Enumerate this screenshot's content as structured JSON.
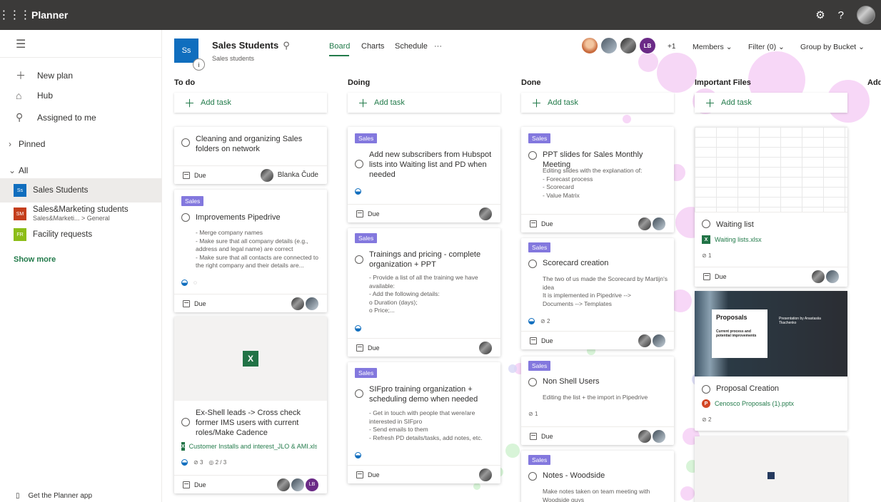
{
  "topbar": {
    "app_name": "Planner"
  },
  "sidebar": {
    "nav": [
      {
        "label": "New plan"
      },
      {
        "label": "Hub"
      },
      {
        "label": "Assigned to me"
      }
    ],
    "pinned_label": "Pinned",
    "all_label": "All",
    "plans": [
      {
        "abbr": "Ss",
        "name": "Sales Students",
        "sub": "",
        "color": "#106ebe"
      },
      {
        "abbr": "SM",
        "name": "Sales&Marketing students",
        "sub": "Sales&Marketi...  >  General",
        "color": "#c43e1c"
      },
      {
        "abbr": "FR",
        "name": "Facility requests",
        "sub": "",
        "color": "#8cbd18"
      }
    ],
    "show_more": "Show more",
    "get_app": "Get the Planner app"
  },
  "header": {
    "plan_abbr": "Ss",
    "plan_title": "Sales Students",
    "plan_sub": "Sales students",
    "tabs": [
      "Board",
      "Charts",
      "Schedule",
      "···"
    ],
    "member_initials": "LB",
    "more_count": "+1",
    "members": "Members",
    "filter": "Filter (0)",
    "group": "Group by Bucket"
  },
  "buckets": [
    {
      "name": "To do"
    },
    {
      "name": "Doing"
    },
    {
      "name": "Done"
    },
    {
      "name": "Important Files"
    },
    {
      "name": "Add"
    }
  ],
  "add_task": "Add task",
  "due": "Due",
  "label_sales": "Sales",
  "cards": {
    "t1": {
      "title": "Cleaning and organizing Sales folders on network",
      "assignee": "Blanka Čude"
    },
    "t2": {
      "title": "Improvements Pipedrive",
      "desc": "- Merge company names\n- Make sure that all company details (e.g., address and legal name) are correct\n- Make sure that all contacts are connected to the right company and their details are..."
    },
    "t3": {
      "title": "Ex-Shell leads -> Cross check former IMS users with current roles/Make Cadence",
      "file": "Customer Installs and interest_JLO & AMI.xlsx",
      "attach": "3",
      "check": "2 / 3",
      "init": "LB"
    },
    "d1": {
      "title": "Add new subscribers from Hubspot lists into Waiting list and PD when needed"
    },
    "d2": {
      "title": "Trainings and pricing - complete organization + PPT",
      "desc": "- Provide a list of all the training we have available:\n- Add the following details:\no Duration (days);\no Price;..."
    },
    "d3": {
      "title": "SIFpro training organization + scheduling demo when needed",
      "desc": "- Get in touch with people that were/are interested in SIFpro\n- Send emails to them\n- Refresh PD details/tasks, add notes, etc."
    },
    "n1": {
      "title": "PPT slides for Sales Monthly Meeting",
      "desc": "Editing slides with the explanation of:\n- Forecast process\n- Scorecard\n- Value Matrix"
    },
    "n2": {
      "title": "Scorecard creation",
      "desc": "The two of us made the Scorecard by Martijn's idea\nIt is implemented in Pipedrive -->\nDocuments --> Templates",
      "attach": "2"
    },
    "n3": {
      "title": "Non Shell Users",
      "desc": "Editing the list + the import in Pipedrive",
      "attach": "1"
    },
    "n4": {
      "title": "Notes - Woodside",
      "desc": "Make notes taken on team meeting with Woodside guys"
    },
    "f1": {
      "title": "Waiting list",
      "file": "Waiting lists.xlsx",
      "attach": "1"
    },
    "f2": {
      "title": "Proposal Creation",
      "file": "Cenosco Proposals (1).pptx",
      "attach": "2",
      "slide_title": "Proposals",
      "slide_sub": "Current process and potential improvements",
      "slide_by": "Presentation by Anastasiia Tkachenko"
    }
  }
}
